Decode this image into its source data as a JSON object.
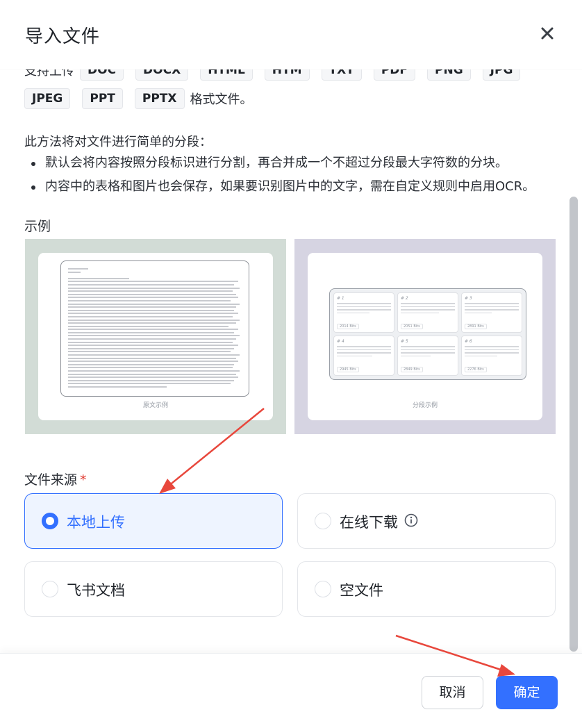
{
  "dialog": {
    "title": "导入文件"
  },
  "formats": {
    "prefix": "支持上传",
    "row1": [
      "DOC",
      "DOCX",
      "HTML",
      "HTM",
      "TXT",
      "PDF",
      "PNG",
      "JPG"
    ],
    "row2": [
      "JPEG",
      "PPT",
      "PPTX"
    ],
    "suffix": "格式文件。"
  },
  "method": {
    "intro": "此方法将对文件进行简单的分段：",
    "bullets": [
      "默认会将内容按照分段标识进行分割，再合并成一个不超过分段最大字符数的分块。",
      "内容中的表格和图片也会保存，如果要识别图片中的文字，需在自定义规则中启用OCR。"
    ]
  },
  "example": {
    "label": "示例",
    "original_caption": "原文示例",
    "segment_caption": "分段示例",
    "segment_numbers": [
      "# 1",
      "# 2",
      "# 3",
      "# 4",
      "# 5",
      "# 6"
    ],
    "segment_sizes": [
      "2014 Bits",
      "2051 Bits",
      "2891 Bits",
      "2945 Bits",
      "2849 Bits",
      "2276 Bits"
    ]
  },
  "source": {
    "label": "文件来源",
    "required_mark": "*",
    "options": [
      {
        "label": "本地上传",
        "selected": true
      },
      {
        "label": "在线下载",
        "selected": false
      },
      {
        "label": "飞书文档",
        "selected": false
      },
      {
        "label": "空文件",
        "selected": false
      }
    ]
  },
  "footer": {
    "cancel": "取消",
    "confirm": "确定"
  },
  "colors": {
    "primary": "#3370ff",
    "annotation_arrow": "#e8473c",
    "required": "#e0352b"
  }
}
